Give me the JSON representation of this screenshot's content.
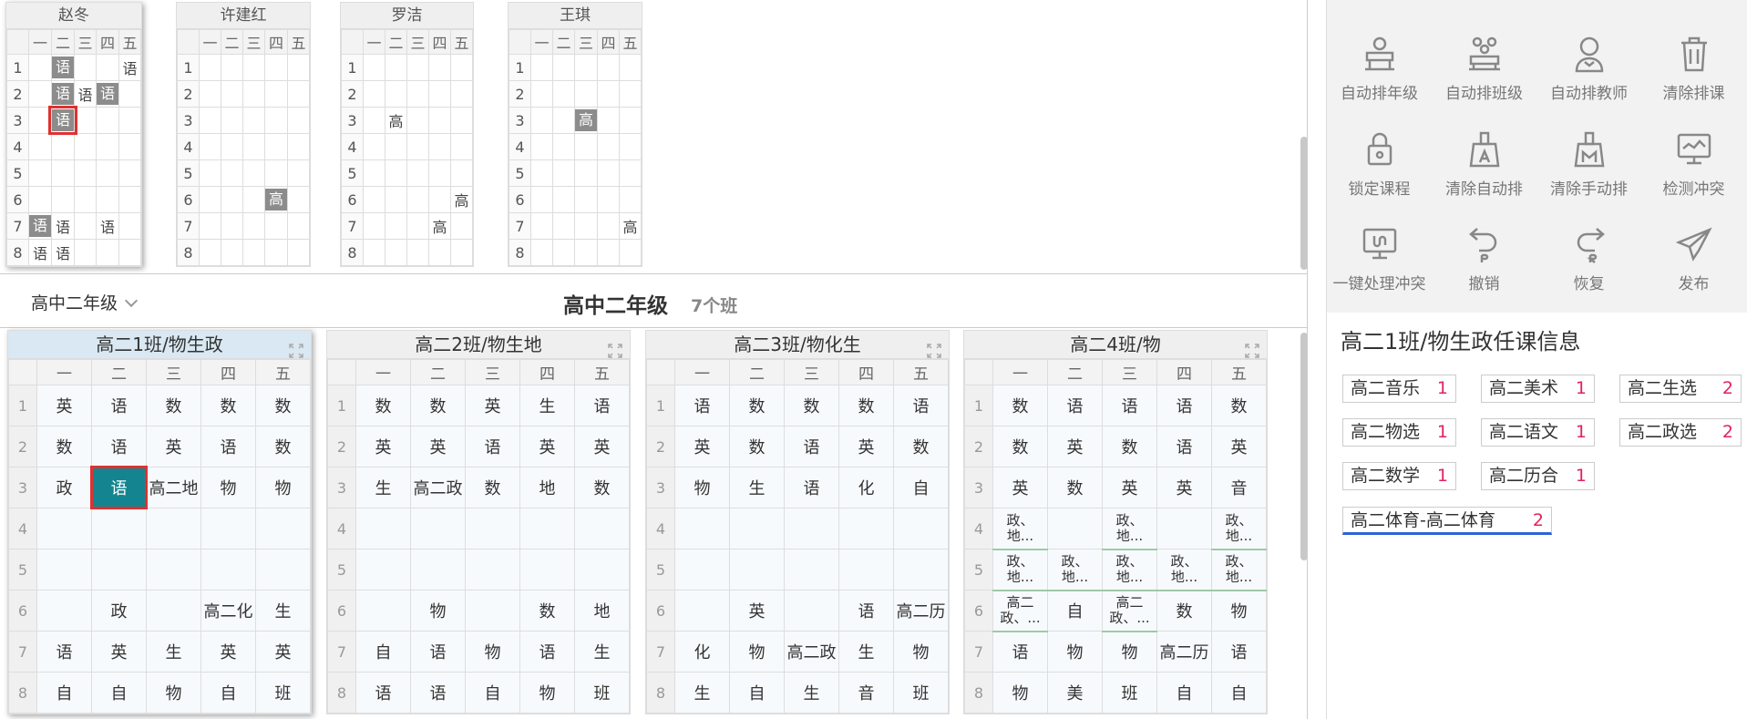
{
  "teachers": [
    {
      "name": "赵冬",
      "days": [
        "一",
        "二",
        "三",
        "四",
        "五"
      ],
      "rows": [
        {
          "p": "1",
          "c": [
            {
              "t": ""
            },
            {
              "t": "语",
              "f": 1
            },
            {
              "t": ""
            },
            {
              "t": ""
            },
            {
              "t": "语"
            }
          ]
        },
        {
          "p": "2",
          "c": [
            {
              "t": ""
            },
            {
              "t": "语",
              "f": 1
            },
            {
              "t": "语"
            },
            {
              "t": "语",
              "f": 1
            },
            {
              "t": ""
            }
          ]
        },
        {
          "p": "3",
          "c": [
            {
              "t": ""
            },
            {
              "t": "语",
              "f": 1,
              "s": 1
            },
            {
              "t": ""
            },
            {
              "t": ""
            },
            {
              "t": ""
            }
          ]
        },
        {
          "p": "4",
          "c": [
            {
              "t": ""
            },
            {
              "t": ""
            },
            {
              "t": ""
            },
            {
              "t": ""
            },
            {
              "t": ""
            }
          ]
        },
        {
          "p": "5",
          "c": [
            {
              "t": ""
            },
            {
              "t": ""
            },
            {
              "t": ""
            },
            {
              "t": ""
            },
            {
              "t": ""
            }
          ]
        },
        {
          "p": "6",
          "c": [
            {
              "t": ""
            },
            {
              "t": ""
            },
            {
              "t": ""
            },
            {
              "t": ""
            },
            {
              "t": ""
            }
          ]
        },
        {
          "p": "7",
          "c": [
            {
              "t": "语",
              "f": 1
            },
            {
              "t": "语"
            },
            {
              "t": ""
            },
            {
              "t": "语"
            },
            {
              "t": ""
            }
          ]
        },
        {
          "p": "8",
          "c": [
            {
              "t": "语"
            },
            {
              "t": "语"
            },
            {
              "t": ""
            },
            {
              "t": ""
            },
            {
              "t": ""
            }
          ]
        }
      ]
    },
    {
      "name": "许建红",
      "days": [
        "一",
        "二",
        "三",
        "四",
        "五"
      ],
      "rows": [
        {
          "p": "1",
          "c": [
            {
              "t": ""
            },
            {
              "t": ""
            },
            {
              "t": ""
            },
            {
              "t": ""
            },
            {
              "t": ""
            }
          ]
        },
        {
          "p": "2",
          "c": [
            {
              "t": ""
            },
            {
              "t": ""
            },
            {
              "t": ""
            },
            {
              "t": ""
            },
            {
              "t": ""
            }
          ]
        },
        {
          "p": "3",
          "c": [
            {
              "t": ""
            },
            {
              "t": ""
            },
            {
              "t": ""
            },
            {
              "t": ""
            },
            {
              "t": ""
            }
          ]
        },
        {
          "p": "4",
          "c": [
            {
              "t": ""
            },
            {
              "t": ""
            },
            {
              "t": ""
            },
            {
              "t": ""
            },
            {
              "t": ""
            }
          ]
        },
        {
          "p": "5",
          "c": [
            {
              "t": ""
            },
            {
              "t": ""
            },
            {
              "t": ""
            },
            {
              "t": ""
            },
            {
              "t": ""
            }
          ]
        },
        {
          "p": "6",
          "c": [
            {
              "t": ""
            },
            {
              "t": ""
            },
            {
              "t": ""
            },
            {
              "t": "高",
              "f": 1
            },
            {
              "t": ""
            }
          ]
        },
        {
          "p": "7",
          "c": [
            {
              "t": ""
            },
            {
              "t": ""
            },
            {
              "t": ""
            },
            {
              "t": ""
            },
            {
              "t": ""
            }
          ]
        },
        {
          "p": "8",
          "c": [
            {
              "t": ""
            },
            {
              "t": ""
            },
            {
              "t": ""
            },
            {
              "t": ""
            },
            {
              "t": ""
            }
          ]
        }
      ]
    },
    {
      "name": "罗洁",
      "days": [
        "一",
        "二",
        "三",
        "四",
        "五"
      ],
      "rows": [
        {
          "p": "1",
          "c": [
            {
              "t": ""
            },
            {
              "t": ""
            },
            {
              "t": ""
            },
            {
              "t": ""
            },
            {
              "t": ""
            }
          ]
        },
        {
          "p": "2",
          "c": [
            {
              "t": ""
            },
            {
              "t": ""
            },
            {
              "t": ""
            },
            {
              "t": ""
            },
            {
              "t": ""
            }
          ]
        },
        {
          "p": "3",
          "c": [
            {
              "t": ""
            },
            {
              "t": "高"
            },
            {
              "t": ""
            },
            {
              "t": ""
            },
            {
              "t": ""
            }
          ]
        },
        {
          "p": "4",
          "c": [
            {
              "t": ""
            },
            {
              "t": ""
            },
            {
              "t": ""
            },
            {
              "t": ""
            },
            {
              "t": ""
            }
          ]
        },
        {
          "p": "5",
          "c": [
            {
              "t": ""
            },
            {
              "t": ""
            },
            {
              "t": ""
            },
            {
              "t": ""
            },
            {
              "t": ""
            }
          ]
        },
        {
          "p": "6",
          "c": [
            {
              "t": ""
            },
            {
              "t": ""
            },
            {
              "t": ""
            },
            {
              "t": ""
            },
            {
              "t": "高"
            }
          ]
        },
        {
          "p": "7",
          "c": [
            {
              "t": ""
            },
            {
              "t": ""
            },
            {
              "t": ""
            },
            {
              "t": "高"
            },
            {
              "t": ""
            }
          ]
        },
        {
          "p": "8",
          "c": [
            {
              "t": ""
            },
            {
              "t": ""
            },
            {
              "t": ""
            },
            {
              "t": ""
            },
            {
              "t": ""
            }
          ]
        }
      ]
    },
    {
      "name": "王琪",
      "days": [
        "一",
        "二",
        "三",
        "四",
        "五"
      ],
      "rows": [
        {
          "p": "1",
          "c": [
            {
              "t": ""
            },
            {
              "t": ""
            },
            {
              "t": ""
            },
            {
              "t": ""
            },
            {
              "t": ""
            }
          ]
        },
        {
          "p": "2",
          "c": [
            {
              "t": ""
            },
            {
              "t": ""
            },
            {
              "t": ""
            },
            {
              "t": ""
            },
            {
              "t": ""
            }
          ]
        },
        {
          "p": "3",
          "c": [
            {
              "t": ""
            },
            {
              "t": ""
            },
            {
              "t": "高",
              "f": 1
            },
            {
              "t": ""
            },
            {
              "t": ""
            }
          ]
        },
        {
          "p": "4",
          "c": [
            {
              "t": ""
            },
            {
              "t": ""
            },
            {
              "t": ""
            },
            {
              "t": ""
            },
            {
              "t": ""
            }
          ]
        },
        {
          "p": "5",
          "c": [
            {
              "t": ""
            },
            {
              "t": ""
            },
            {
              "t": ""
            },
            {
              "t": ""
            },
            {
              "t": ""
            }
          ]
        },
        {
          "p": "6",
          "c": [
            {
              "t": ""
            },
            {
              "t": ""
            },
            {
              "t": ""
            },
            {
              "t": ""
            },
            {
              "t": ""
            }
          ]
        },
        {
          "p": "7",
          "c": [
            {
              "t": ""
            },
            {
              "t": ""
            },
            {
              "t": ""
            },
            {
              "t": ""
            },
            {
              "t": "高"
            }
          ]
        },
        {
          "p": "8",
          "c": [
            {
              "t": ""
            },
            {
              "t": ""
            },
            {
              "t": ""
            },
            {
              "t": ""
            },
            {
              "t": ""
            }
          ]
        }
      ]
    }
  ],
  "grade": {
    "select_label": "高中二年级",
    "title": "高中二年级",
    "count": "7个班"
  },
  "classes": [
    {
      "name": "高二1班/物生政",
      "days": [
        "一",
        "二",
        "三",
        "四",
        "五"
      ],
      "rows": [
        {
          "p": "1",
          "c": [
            "英",
            "语",
            "数",
            "数",
            "数"
          ]
        },
        {
          "p": "2",
          "c": [
            "数",
            "语",
            "英",
            "语",
            "数"
          ]
        },
        {
          "p": "3",
          "c": [
            "政",
            "语",
            "高二地",
            "物",
            "物"
          ]
        },
        {
          "p": "4",
          "c": [
            "",
            "",
            "",
            "",
            ""
          ]
        },
        {
          "p": "5",
          "c": [
            "",
            "",
            "",
            "",
            ""
          ]
        },
        {
          "p": "6",
          "c": [
            "",
            "政",
            "",
            "高二化",
            "生"
          ]
        },
        {
          "p": "7",
          "c": [
            "语",
            "英",
            "生",
            "英",
            "英"
          ]
        },
        {
          "p": "8",
          "c": [
            "自",
            "自",
            "物",
            "自",
            "班"
          ]
        }
      ]
    },
    {
      "name": "高二2班/物生地",
      "days": [
        "一",
        "二",
        "三",
        "四",
        "五"
      ],
      "rows": [
        {
          "p": "1",
          "c": [
            "数",
            "数",
            "英",
            "生",
            "语"
          ]
        },
        {
          "p": "2",
          "c": [
            "英",
            "英",
            "语",
            "英",
            "英"
          ]
        },
        {
          "p": "3",
          "c": [
            "生",
            "高二政",
            "数",
            "地",
            "数"
          ]
        },
        {
          "p": "4",
          "c": [
            "",
            "",
            "",
            "",
            ""
          ]
        },
        {
          "p": "5",
          "c": [
            "",
            "",
            "",
            "",
            ""
          ]
        },
        {
          "p": "6",
          "c": [
            "",
            "物",
            "",
            "数",
            "地"
          ]
        },
        {
          "p": "7",
          "c": [
            "自",
            "语",
            "物",
            "语",
            "生"
          ]
        },
        {
          "p": "8",
          "c": [
            "语",
            "语",
            "自",
            "物",
            "班"
          ]
        }
      ]
    },
    {
      "name": "高二3班/物化生",
      "days": [
        "一",
        "二",
        "三",
        "四",
        "五"
      ],
      "rows": [
        {
          "p": "1",
          "c": [
            "语",
            "数",
            "数",
            "数",
            "语"
          ]
        },
        {
          "p": "2",
          "c": [
            "英",
            "数",
            "语",
            "英",
            "数"
          ]
        },
        {
          "p": "3",
          "c": [
            "物",
            "生",
            "语",
            "化",
            "自"
          ]
        },
        {
          "p": "4",
          "c": [
            "",
            "",
            "",
            "",
            ""
          ]
        },
        {
          "p": "5",
          "c": [
            "",
            "",
            "",
            "",
            ""
          ]
        },
        {
          "p": "6",
          "c": [
            "",
            "英",
            "",
            "语",
            "高二历"
          ]
        },
        {
          "p": "7",
          "c": [
            "化",
            "物",
            "高二政",
            "生",
            "物"
          ]
        },
        {
          "p": "8",
          "c": [
            "生",
            "自",
            "生",
            "音",
            "班"
          ]
        }
      ]
    },
    {
      "name": "高二4班/物",
      "days": [
        "一",
        "二",
        "三",
        "四",
        "五"
      ],
      "rows": [
        {
          "p": "1",
          "c": [
            "数",
            "语",
            "语",
            "语",
            "数"
          ]
        },
        {
          "p": "2",
          "c": [
            "数",
            "英",
            "数",
            "语",
            "英"
          ]
        },
        {
          "p": "3",
          "c": [
            "英",
            "数",
            "英",
            "英",
            "音"
          ]
        },
        {
          "p": "4",
          "c": [
            "政、\n地...",
            "",
            "政、\n地...",
            "",
            "政、\n地..."
          ]
        },
        {
          "p": "5",
          "c": [
            "政、\n地...",
            "政、\n地...",
            "政、\n地...",
            "政、\n地...",
            "政、\n地..."
          ]
        },
        {
          "p": "6",
          "c": [
            "高二\n政、...",
            "自",
            "高二\n政、...",
            "数",
            "物"
          ]
        },
        {
          "p": "7",
          "c": [
            "语",
            "物",
            "物",
            "高二历",
            "语"
          ]
        },
        {
          "p": "8",
          "c": [
            "物",
            "美",
            "班",
            "自",
            "自"
          ]
        }
      ]
    }
  ],
  "toolbar": [
    {
      "label": "自动排年级",
      "icon": "auto-grade-icon"
    },
    {
      "label": "自动排班级",
      "icon": "auto-class-icon"
    },
    {
      "label": "自动排教师",
      "icon": "auto-teacher-icon"
    },
    {
      "label": "清除排课",
      "icon": "trash-icon"
    },
    {
      "label": "锁定课程",
      "icon": "lock-icon"
    },
    {
      "label": "清除自动排",
      "icon": "broom-auto-icon"
    },
    {
      "label": "清除手动排",
      "icon": "broom-manual-icon"
    },
    {
      "label": "检测冲突",
      "icon": "monitor-check-icon"
    },
    {
      "label": "一键处理冲突",
      "icon": "monitor-fix-icon"
    },
    {
      "label": "撤销",
      "icon": "undo-icon"
    },
    {
      "label": "恢复",
      "icon": "redo-icon"
    },
    {
      "label": "发布",
      "icon": "send-icon"
    }
  ],
  "info": {
    "title": "高二1班/物生政任课信息",
    "courses": [
      {
        "name": "高二音乐",
        "count": "1"
      },
      {
        "name": "高二美术",
        "count": "1"
      },
      {
        "name": "高二生选",
        "count": "2"
      },
      {
        "name": "高二物选",
        "count": "1"
      },
      {
        "name": "高二语文",
        "count": "1"
      },
      {
        "name": "高二政选",
        "count": "2"
      },
      {
        "name": "高二数学",
        "count": "1"
      },
      {
        "name": "高二历合",
        "count": "1"
      },
      {
        "name": "高二体育-高二体育",
        "count": "2"
      }
    ]
  },
  "colors": {
    "selected_fill": "#148590",
    "selected_border": "#e03030",
    "count_color": "#e0245e",
    "underline": "#2d63d8"
  }
}
